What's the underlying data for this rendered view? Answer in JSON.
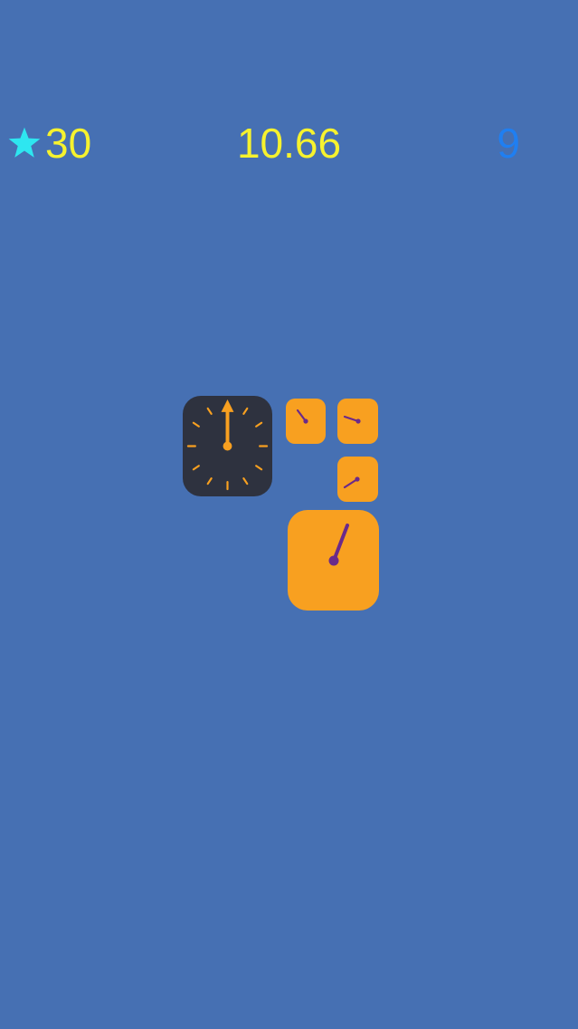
{
  "hud": {
    "score": "30",
    "timer": "10.66",
    "level": "9",
    "star_icon": "star-icon"
  },
  "colors": {
    "background": "#4670b3",
    "star": "#2ee6f0",
    "score_text": "#f6f22e",
    "level_text": "#1f7ff2",
    "tile_orange": "#f8a020",
    "tile_dark": "#2e323f",
    "hand_purple": "#6b2a8a"
  },
  "clocks": [
    {
      "name": "target-clock-dark",
      "hand_angle_deg": 0
    },
    {
      "name": "clock-small-1",
      "hand_angle_deg": -35
    },
    {
      "name": "clock-small-2",
      "hand_angle_deg": -70
    },
    {
      "name": "clock-small-3",
      "hand_angle_deg": 240
    },
    {
      "name": "clock-large",
      "hand_angle_deg": 25
    }
  ]
}
